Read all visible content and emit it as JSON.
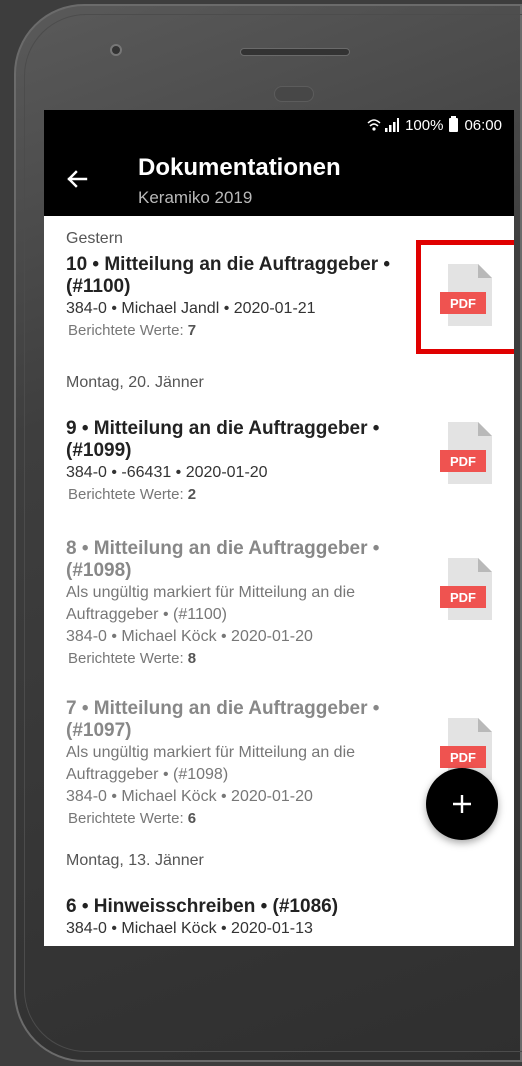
{
  "status_bar": {
    "battery": "100%",
    "time": "06:00",
    "icons": [
      "wifi-icon",
      "signal-icon",
      "battery-icon"
    ]
  },
  "app_bar": {
    "title": "Dokumentationen",
    "subtitle": "Keramiko 2019",
    "back_icon": "arrow-left-icon"
  },
  "sections": [
    {
      "header": "Gestern",
      "entries": [
        {
          "title_line1": "10 • Mitteilung an die Auftraggeber •",
          "title_line2": "(#1100)",
          "meta": "384-0 • Michael Jandl • 2020-01-21",
          "values_label": "Berichtete Werte:",
          "values_count": "7",
          "pdf_label": "PDF"
        }
      ]
    },
    {
      "header": "Montag, 20. Jänner",
      "entries": [
        {
          "title_line1": "9 • Mitteilung an die Auftraggeber •",
          "title_line2": "(#1099)",
          "meta": "384-0 • -66431 • 2020-01-20",
          "values_label": "Berichtete Werte:",
          "values_count": "2",
          "pdf_label": "PDF"
        },
        {
          "title_line1": "8 • Mitteilung an die Auftraggeber •",
          "title_line2": "(#1098)",
          "note_line1": "Als ungültig markiert für Mitteilung an die",
          "note_line2": "Auftraggeber • (#1100)",
          "meta": "384-0 • Michael Köck • 2020-01-20",
          "values_label": "Berichtete Werte:",
          "values_count": "8",
          "pdf_label": "PDF"
        },
        {
          "title_line1": "7 • Mitteilung an die Auftraggeber •",
          "title_line2": "(#1097)",
          "note_line1": "Als ungültig markiert für Mitteilung an die",
          "note_line2": "Auftraggeber • (#1098)",
          "meta": "384-0 • Michael Köck • 2020-01-20",
          "values_label": "Berichtete Werte:",
          "values_count": "6",
          "pdf_label": "PDF"
        }
      ]
    },
    {
      "header": "Montag, 13. Jänner",
      "entries": [
        {
          "title_line1": "6 • Hinweisschreiben • (#1086)",
          "meta": "384-0 • Michael Köck • 2020-01-13"
        }
      ]
    }
  ],
  "fab": {
    "label": "+",
    "icon": "plus-icon"
  },
  "colors": {
    "pdf_red": "#ef5350",
    "pdf_page": "#e3e3e3",
    "pdf_fold": "#b9b9b9",
    "highlight": "#e00000",
    "app_bar": "#000000"
  }
}
